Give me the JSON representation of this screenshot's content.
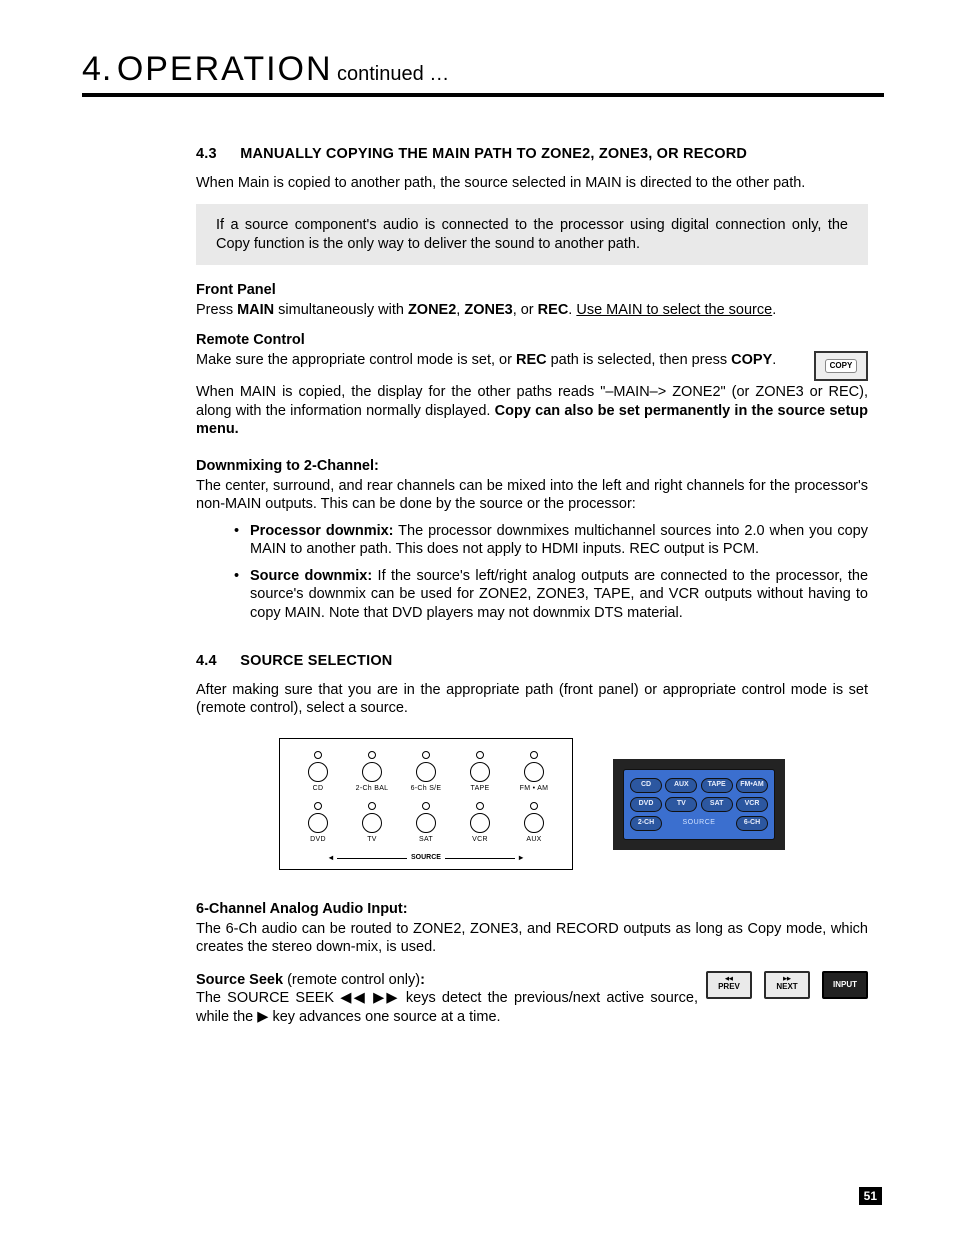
{
  "header": {
    "section_number": "4.",
    "section_title": "OPERATION",
    "continued": "continued …"
  },
  "s43": {
    "num": "4.3",
    "title": "MANUALLY COPYING THE MAIN PATH TO ZONE2, ZONE3, OR RECORD",
    "intro": "When Main is copied to another path, the source selected in MAIN is directed to the other path.",
    "note": "If a source component's audio is connected to the processor using digital connection only, the Copy function is the only way to deliver the sound to another path.",
    "front_panel_hd": "Front Panel",
    "front_panel_pre": "Press ",
    "front_main": "MAIN",
    "front_mid1": " simultaneously with ",
    "front_zone2": "ZONE2",
    "front_comma1": ", ",
    "front_zone3": "ZONE3",
    "front_or": ", or ",
    "front_rec": "REC",
    "front_period": ". ",
    "front_under": "Use MAIN to select the source",
    "front_tail": ".",
    "remote_hd": "Remote Control",
    "remote_pre": "Make sure the appropriate control mode is set, or ",
    "remote_rec": "REC",
    "remote_mid": " path is selected, then press ",
    "remote_copy": "COPY",
    "remote_tail": ".",
    "copy_btn": "COPY",
    "copy_result_pre": "When MAIN is copied, the display for the other paths reads \"–MAIN–> ZONE2\" (or ZONE3 or REC), along with the information normally displayed. ",
    "copy_result_bold": "Copy can also be set permanently in the source setup menu.",
    "downmix_hd": "Downmixing to 2-Channel:",
    "downmix_body": "The center, surround, and rear channels can be mixed into the left and right channels for the processor's non-MAIN outputs. This can be done by the source or the processor:",
    "bul1_b": "Processor downmix:",
    "bul1_t": " The processor downmixes multichannel sources into 2.0 when you copy MAIN to another path. This does not apply to HDMI inputs. REC output is PCM.",
    "bul2_b": "Source downmix:",
    "bul2_t": "  If the source's left/right analog outputs are connected to the processor, the source's downmix can be used for ZONE2, ZONE3, TAPE, and VCR outputs without having to copy MAIN. Note that DVD players may not downmix DTS material."
  },
  "s44": {
    "num": "4.4",
    "title": "SOURCE SELECTION",
    "intro": "After making sure that you are in the appropriate path (front panel) or appropriate control mode is set (remote control), select a source.",
    "front_panel_buttons_row1": [
      "CD",
      "2-Ch BAL",
      "6-Ch S/E",
      "TAPE",
      "FM • AM"
    ],
    "front_panel_buttons_row2": [
      "DVD",
      "TV",
      "SAT",
      "VCR",
      "AUX"
    ],
    "front_source_label": "SOURCE",
    "remote_row1": [
      "CD",
      "AUX",
      "TAPE",
      "FM•AM"
    ],
    "remote_row2": [
      "DVD",
      "TV",
      "SAT",
      "VCR"
    ],
    "remote_row3_left": "2-CH",
    "remote_source_label": "SOURCE",
    "remote_row3_right": "6-CH",
    "six_ch_hd": "6-Channel Analog Audio Input:",
    "six_ch_body": "The 6-Ch audio can be routed to ZONE2, ZONE3, and RECORD outputs as long as Copy mode, which creates the stereo down-mix, is used.",
    "seek_hd": "Source Seek",
    "seek_hd_tail": " (remote control only)",
    "seek_hd_colon": ":",
    "seek_body_a": "The SOURCE SEEK ",
    "seek_rew": "◀◀",
    "seek_sp": " ",
    "seek_fwd": "▶▶",
    "seek_body_b": " keys detect the previous/next active source, while the ",
    "seek_play": "▶",
    "seek_body_c": " key advances one source at a time.",
    "btn_prev": "PREV",
    "btn_next": "NEXT",
    "btn_input": "INPUT",
    "btn_prev_tiny": "◀◀",
    "btn_next_tiny": "▶▶"
  },
  "page_number": "51"
}
